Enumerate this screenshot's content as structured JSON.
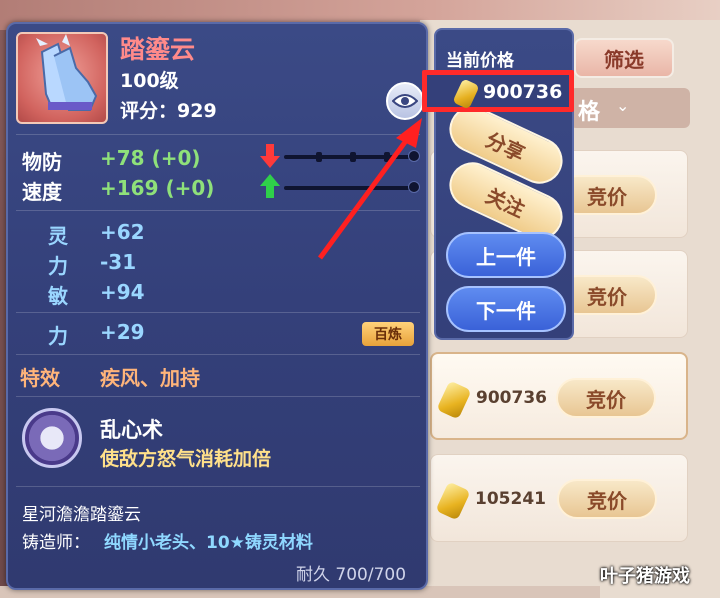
{
  "item": {
    "name": "踏鎏云",
    "level": "100级",
    "score": "评分：929"
  },
  "stats": [
    {
      "label": "物防",
      "value": "+78",
      "bonus": "(+0)"
    },
    {
      "label": "速度",
      "value": "+169",
      "bonus": "(+0)"
    }
  ],
  "attrs": [
    {
      "label": "灵",
      "value": "+62"
    },
    {
      "label": "力",
      "value": "-31"
    },
    {
      "label": "敏",
      "value": "+94"
    }
  ],
  "refine": {
    "label": "力",
    "value": "+29",
    "badge": "百炼"
  },
  "effect": {
    "label": "特效",
    "value": "疾风、加持"
  },
  "skill": {
    "name": "乱心术",
    "desc": "使敌方怒气消耗加倍"
  },
  "lore": "星河澹澹踏鎏云",
  "maker": {
    "label": "铸造师：",
    "value": "纯情小老头、10★铸灵材料"
  },
  "durability": "耐久 700/700",
  "actions": {
    "current_price_label": "当前价格",
    "current_price": "900736",
    "share": "分享",
    "follow": "关注",
    "prev": "上一件",
    "next": "下一件"
  },
  "market": {
    "filter": "筛选",
    "sort_label": "格",
    "bid_label": "竞价",
    "row_prices": [
      "900736",
      "105241"
    ]
  },
  "watermark": "叶子猪游戏",
  "colors": {
    "highlight": "#ff2a2a",
    "card_bg": "#34407a"
  }
}
